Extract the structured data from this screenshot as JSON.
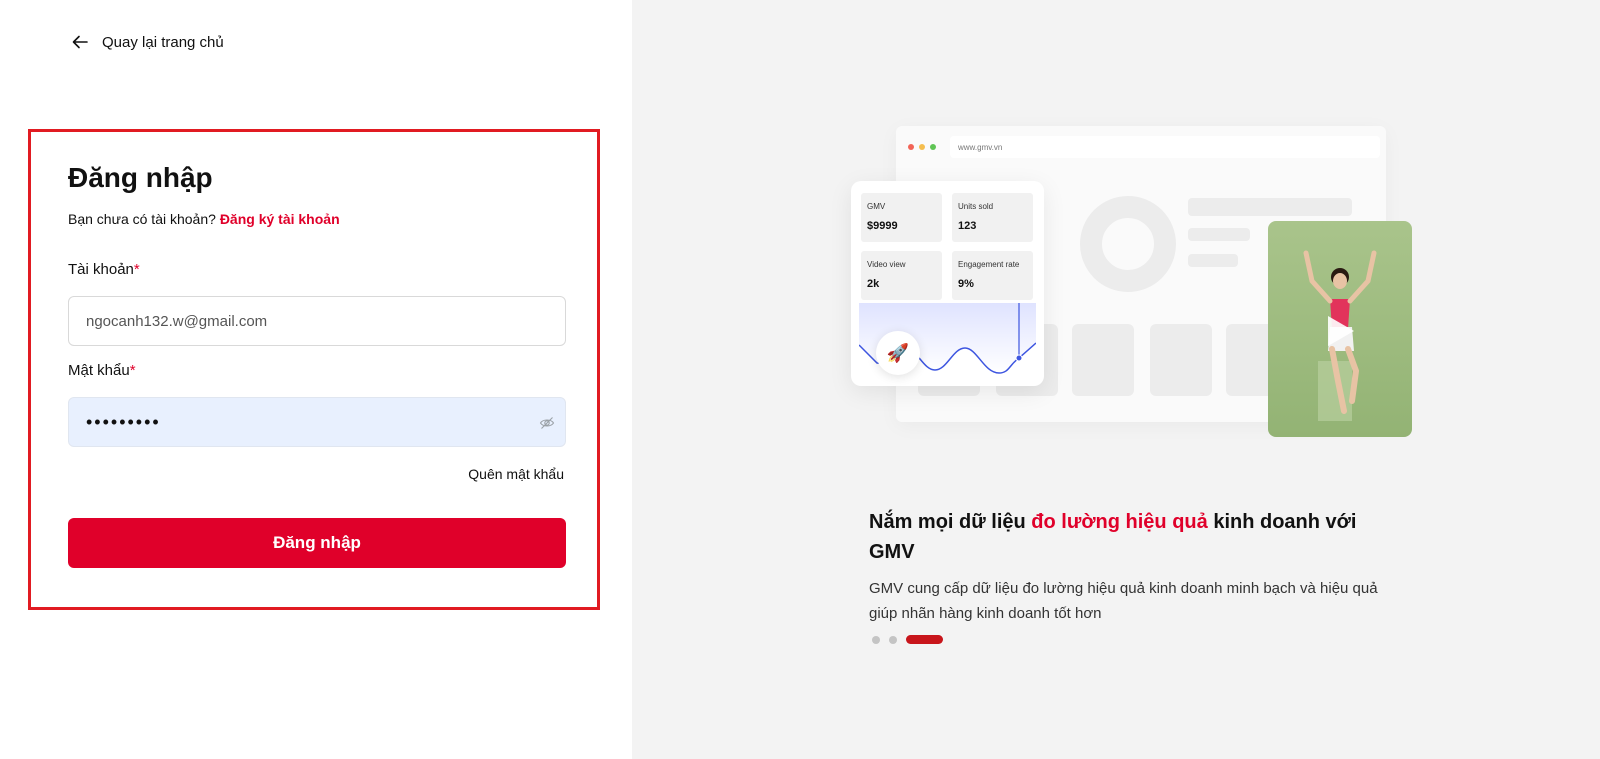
{
  "back_link": {
    "label": "Quay lại trang chủ",
    "icon": "arrow-left-icon"
  },
  "login": {
    "title": "Đăng nhập",
    "no_account_text": "Bạn chưa có tài khoản?",
    "register_link": "Đăng ký tài khoản",
    "username_label": "Tài khoản",
    "password_label": "Mật khẩu",
    "required_mark": "*",
    "username_value": "ngocanh132.w@gmail.com",
    "password_value": "•••••••••",
    "forgot_password": "Quên mật khẩu",
    "submit_label": "Đăng nhập",
    "eye_icon": "eye-off-icon"
  },
  "illustration": {
    "url": "www.gmv.vn",
    "stats": [
      {
        "label": "GMV",
        "value": "$9999"
      },
      {
        "label": "Units sold",
        "value": "123"
      },
      {
        "label": "Video view",
        "value": "2k"
      },
      {
        "label": "Engagement rate",
        "value": "9%"
      }
    ],
    "rocket_icon": "rocket-icon",
    "play_icon": "play-icon"
  },
  "promo": {
    "headline_part1": "Nắm mọi dữ liệu ",
    "headline_highlight": "đo lường hiệu quả",
    "headline_part2": " kinh doanh với GMV",
    "description": "GMV cung cấp dữ liệu đo lường hiệu quả kinh doanh minh bạch và hiệu quả giúp nhãn hàng kinh doanh tốt hơn",
    "slides_total": 3,
    "active_slide": 3
  },
  "colors": {
    "brand_red": "#e0002a",
    "frame_red": "#e11b22",
    "right_bg": "#f3f3f3",
    "autofill_bg": "#e8f0fe"
  }
}
